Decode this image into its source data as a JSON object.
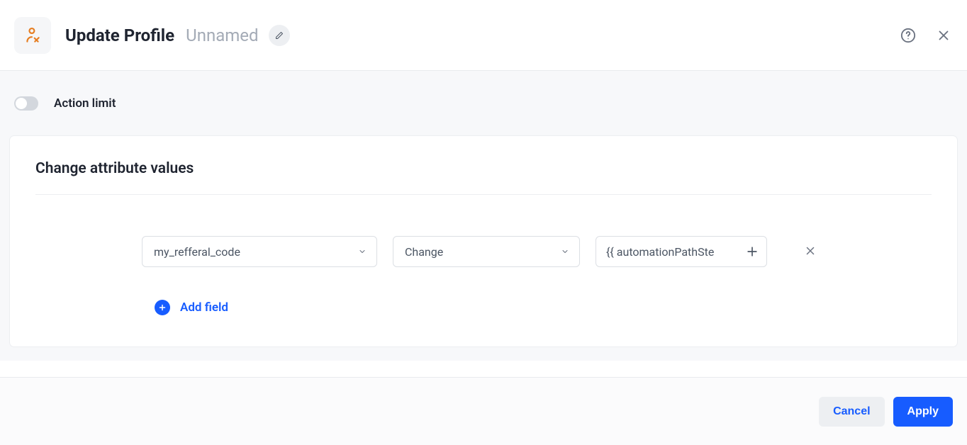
{
  "header": {
    "title": "Update Profile",
    "subtitle": "Unnamed"
  },
  "limit": {
    "label": "Action limit",
    "enabled": false
  },
  "card": {
    "title": "Change attribute values"
  },
  "row": {
    "attribute": "my_refferal_code",
    "action": "Change",
    "value": "{{ automationPathSte"
  },
  "actions": {
    "add_field": "Add field"
  },
  "footer": {
    "cancel": "Cancel",
    "apply": "Apply"
  }
}
